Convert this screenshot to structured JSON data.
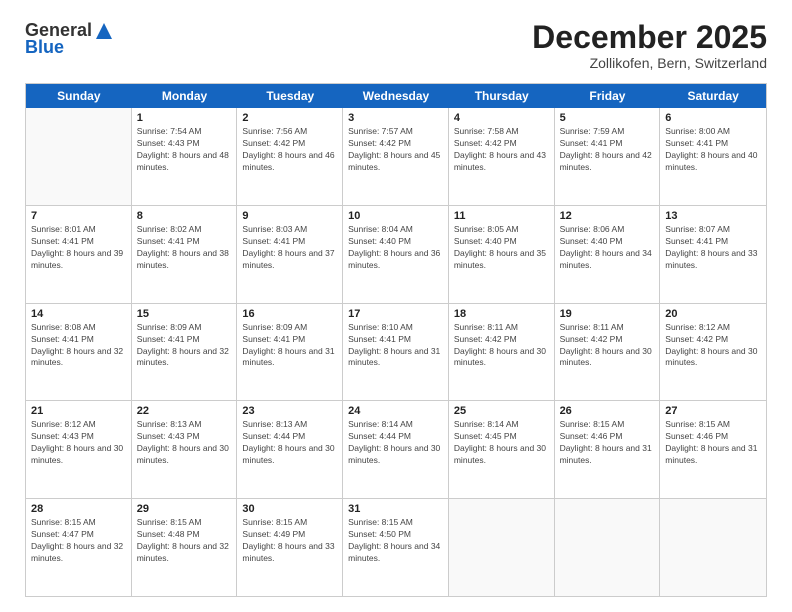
{
  "header": {
    "logo": {
      "general": "General",
      "blue": "Blue"
    },
    "title": "December 2025",
    "location": "Zollikofen, Bern, Switzerland"
  },
  "weekdays": [
    "Sunday",
    "Monday",
    "Tuesday",
    "Wednesday",
    "Thursday",
    "Friday",
    "Saturday"
  ],
  "weeks": [
    [
      {
        "day": "",
        "empty": true
      },
      {
        "day": "1",
        "sunrise": "Sunrise: 7:54 AM",
        "sunset": "Sunset: 4:43 PM",
        "daylight": "Daylight: 8 hours and 48 minutes."
      },
      {
        "day": "2",
        "sunrise": "Sunrise: 7:56 AM",
        "sunset": "Sunset: 4:42 PM",
        "daylight": "Daylight: 8 hours and 46 minutes."
      },
      {
        "day": "3",
        "sunrise": "Sunrise: 7:57 AM",
        "sunset": "Sunset: 4:42 PM",
        "daylight": "Daylight: 8 hours and 45 minutes."
      },
      {
        "day": "4",
        "sunrise": "Sunrise: 7:58 AM",
        "sunset": "Sunset: 4:42 PM",
        "daylight": "Daylight: 8 hours and 43 minutes."
      },
      {
        "day": "5",
        "sunrise": "Sunrise: 7:59 AM",
        "sunset": "Sunset: 4:41 PM",
        "daylight": "Daylight: 8 hours and 42 minutes."
      },
      {
        "day": "6",
        "sunrise": "Sunrise: 8:00 AM",
        "sunset": "Sunset: 4:41 PM",
        "daylight": "Daylight: 8 hours and 40 minutes."
      }
    ],
    [
      {
        "day": "7",
        "sunrise": "Sunrise: 8:01 AM",
        "sunset": "Sunset: 4:41 PM",
        "daylight": "Daylight: 8 hours and 39 minutes."
      },
      {
        "day": "8",
        "sunrise": "Sunrise: 8:02 AM",
        "sunset": "Sunset: 4:41 PM",
        "daylight": "Daylight: 8 hours and 38 minutes."
      },
      {
        "day": "9",
        "sunrise": "Sunrise: 8:03 AM",
        "sunset": "Sunset: 4:41 PM",
        "daylight": "Daylight: 8 hours and 37 minutes."
      },
      {
        "day": "10",
        "sunrise": "Sunrise: 8:04 AM",
        "sunset": "Sunset: 4:40 PM",
        "daylight": "Daylight: 8 hours and 36 minutes."
      },
      {
        "day": "11",
        "sunrise": "Sunrise: 8:05 AM",
        "sunset": "Sunset: 4:40 PM",
        "daylight": "Daylight: 8 hours and 35 minutes."
      },
      {
        "day": "12",
        "sunrise": "Sunrise: 8:06 AM",
        "sunset": "Sunset: 4:40 PM",
        "daylight": "Daylight: 8 hours and 34 minutes."
      },
      {
        "day": "13",
        "sunrise": "Sunrise: 8:07 AM",
        "sunset": "Sunset: 4:41 PM",
        "daylight": "Daylight: 8 hours and 33 minutes."
      }
    ],
    [
      {
        "day": "14",
        "sunrise": "Sunrise: 8:08 AM",
        "sunset": "Sunset: 4:41 PM",
        "daylight": "Daylight: 8 hours and 32 minutes."
      },
      {
        "day": "15",
        "sunrise": "Sunrise: 8:09 AM",
        "sunset": "Sunset: 4:41 PM",
        "daylight": "Daylight: 8 hours and 32 minutes."
      },
      {
        "day": "16",
        "sunrise": "Sunrise: 8:09 AM",
        "sunset": "Sunset: 4:41 PM",
        "daylight": "Daylight: 8 hours and 31 minutes."
      },
      {
        "day": "17",
        "sunrise": "Sunrise: 8:10 AM",
        "sunset": "Sunset: 4:41 PM",
        "daylight": "Daylight: 8 hours and 31 minutes."
      },
      {
        "day": "18",
        "sunrise": "Sunrise: 8:11 AM",
        "sunset": "Sunset: 4:42 PM",
        "daylight": "Daylight: 8 hours and 30 minutes."
      },
      {
        "day": "19",
        "sunrise": "Sunrise: 8:11 AM",
        "sunset": "Sunset: 4:42 PM",
        "daylight": "Daylight: 8 hours and 30 minutes."
      },
      {
        "day": "20",
        "sunrise": "Sunrise: 8:12 AM",
        "sunset": "Sunset: 4:42 PM",
        "daylight": "Daylight: 8 hours and 30 minutes."
      }
    ],
    [
      {
        "day": "21",
        "sunrise": "Sunrise: 8:12 AM",
        "sunset": "Sunset: 4:43 PM",
        "daylight": "Daylight: 8 hours and 30 minutes."
      },
      {
        "day": "22",
        "sunrise": "Sunrise: 8:13 AM",
        "sunset": "Sunset: 4:43 PM",
        "daylight": "Daylight: 8 hours and 30 minutes."
      },
      {
        "day": "23",
        "sunrise": "Sunrise: 8:13 AM",
        "sunset": "Sunset: 4:44 PM",
        "daylight": "Daylight: 8 hours and 30 minutes."
      },
      {
        "day": "24",
        "sunrise": "Sunrise: 8:14 AM",
        "sunset": "Sunset: 4:44 PM",
        "daylight": "Daylight: 8 hours and 30 minutes."
      },
      {
        "day": "25",
        "sunrise": "Sunrise: 8:14 AM",
        "sunset": "Sunset: 4:45 PM",
        "daylight": "Daylight: 8 hours and 30 minutes."
      },
      {
        "day": "26",
        "sunrise": "Sunrise: 8:15 AM",
        "sunset": "Sunset: 4:46 PM",
        "daylight": "Daylight: 8 hours and 31 minutes."
      },
      {
        "day": "27",
        "sunrise": "Sunrise: 8:15 AM",
        "sunset": "Sunset: 4:46 PM",
        "daylight": "Daylight: 8 hours and 31 minutes."
      }
    ],
    [
      {
        "day": "28",
        "sunrise": "Sunrise: 8:15 AM",
        "sunset": "Sunset: 4:47 PM",
        "daylight": "Daylight: 8 hours and 32 minutes."
      },
      {
        "day": "29",
        "sunrise": "Sunrise: 8:15 AM",
        "sunset": "Sunset: 4:48 PM",
        "daylight": "Daylight: 8 hours and 32 minutes."
      },
      {
        "day": "30",
        "sunrise": "Sunrise: 8:15 AM",
        "sunset": "Sunset: 4:49 PM",
        "daylight": "Daylight: 8 hours and 33 minutes."
      },
      {
        "day": "31",
        "sunrise": "Sunrise: 8:15 AM",
        "sunset": "Sunset: 4:50 PM",
        "daylight": "Daylight: 8 hours and 34 minutes."
      },
      {
        "day": "",
        "empty": true
      },
      {
        "day": "",
        "empty": true
      },
      {
        "day": "",
        "empty": true
      }
    ]
  ]
}
